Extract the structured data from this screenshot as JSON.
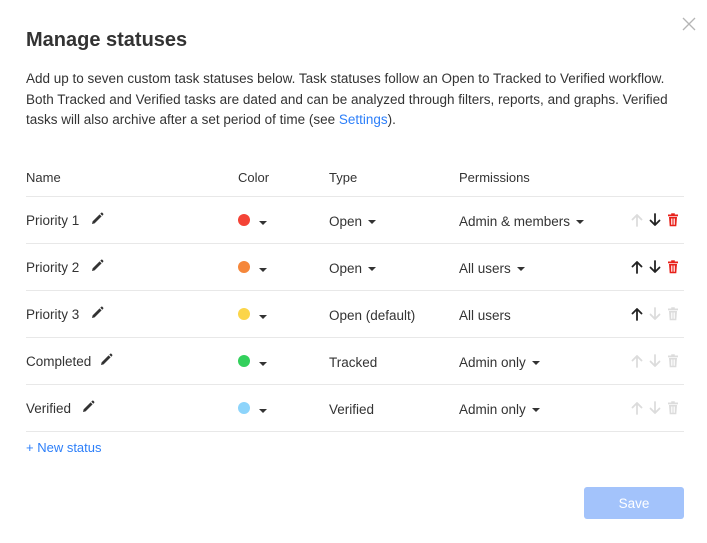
{
  "dialog": {
    "title": "Manage statuses",
    "description_main": "Add up to seven custom task statuses below. Task statuses follow an Open to Tracked to Verified workflow. Both Tracked and Verified tasks are dated and can be analyzed through filters, reports, and graphs. Verified tasks will also archive after a set period of time (see ",
    "description_link": "Settings",
    "description_end": ")."
  },
  "table": {
    "headers": {
      "name": "Name",
      "color": "Color",
      "type": "Type",
      "permissions": "Permissions"
    },
    "rows": [
      {
        "name": "Priority 1",
        "color": "#f44336",
        "type": "Open",
        "type_dropdown": true,
        "permissions": "Admin & members",
        "perm_dropdown": true,
        "up_enabled": false,
        "down_enabled": true,
        "delete_enabled": true
      },
      {
        "name": "Priority 2",
        "color": "#f5873b",
        "type": "Open",
        "type_dropdown": true,
        "permissions": "All users",
        "perm_dropdown": true,
        "up_enabled": true,
        "down_enabled": true,
        "delete_enabled": true
      },
      {
        "name": "Priority 3",
        "color": "#fbd54a",
        "type": "Open (default)",
        "type_dropdown": false,
        "permissions": "All users",
        "perm_dropdown": false,
        "up_enabled": true,
        "down_enabled": false,
        "delete_enabled": false
      },
      {
        "name": "Completed",
        "color": "#33d05c",
        "type": "Tracked",
        "type_dropdown": false,
        "permissions": "Admin only",
        "perm_dropdown": true,
        "up_enabled": false,
        "down_enabled": false,
        "delete_enabled": false
      },
      {
        "name": "Verified",
        "color": "#8dd4fb",
        "type": "Verified",
        "type_dropdown": false,
        "permissions": "Admin only",
        "perm_dropdown": true,
        "up_enabled": false,
        "down_enabled": false,
        "delete_enabled": false
      }
    ]
  },
  "new_status_label": "+ New status",
  "save_label": "Save",
  "colors": {
    "link": "#2d7ff9",
    "delete": "#e8211a",
    "arrow_enabled": "#222222",
    "arrow_disabled": "#dcdcdc",
    "save_bg": "#a3c3fb"
  },
  "icons": {
    "close": "close-icon",
    "edit": "pencil-icon",
    "up": "arrow-up-icon",
    "down": "arrow-down-icon",
    "delete": "trash-icon",
    "dropdown": "caret-down-icon"
  }
}
